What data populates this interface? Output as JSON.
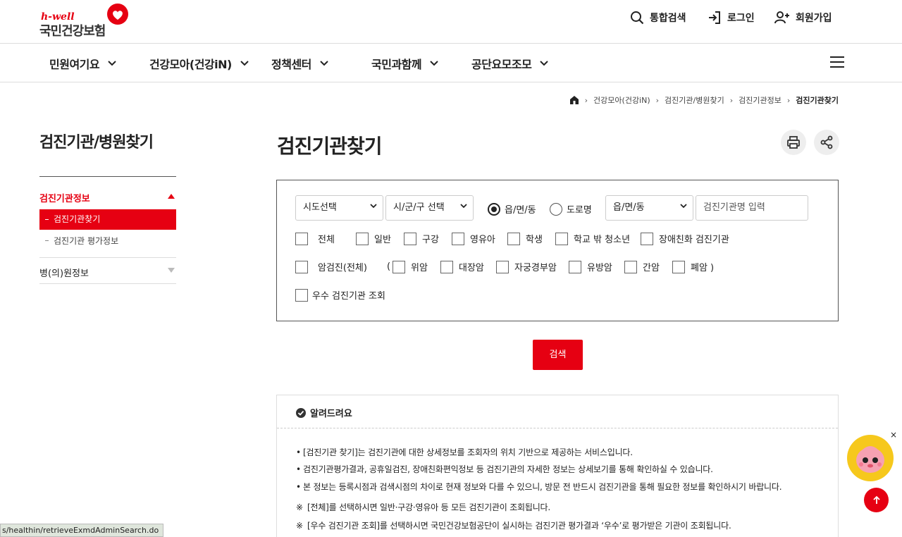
{
  "header": {
    "logo_brand": "h-well",
    "logo_name": "국민건강보험",
    "search_label": "통합검색",
    "login_label": "로그인",
    "join_label": "회원가입"
  },
  "gnb": {
    "items": [
      {
        "label": "민원여기요"
      },
      {
        "label": "건강모아(건강iN)"
      },
      {
        "label": "정책센터"
      },
      {
        "label": "국민과함께"
      },
      {
        "label": "공단요모조모"
      }
    ]
  },
  "breadcrumb": {
    "items": [
      "건강모아(건강iN)",
      "검진기관/병원찾기",
      "검진기관정보"
    ],
    "current": "검진기관찾기"
  },
  "sidebar": {
    "title": "검진기관/병원찾기",
    "group1": "검진기관정보",
    "active_item": "검진기관찾기",
    "sub_item": "검진기관 평가정보",
    "group2": "병(의)원정보"
  },
  "page": {
    "title": "검진기관찾기"
  },
  "search": {
    "sido_select": "시도선택",
    "sigungu_select": "시/군/구 선택",
    "radio_emd": "읍/면/동",
    "radio_road": "도로명",
    "emd_select": "읍/면/동",
    "name_placeholder": "검진기관명 입력",
    "row1": [
      "전체",
      "일반",
      "구강",
      "영유아",
      "학생",
      "학교 밖 청소년",
      "장애친화 검진기관"
    ],
    "cancer_all": "암검진(전체)",
    "paren_open": "(",
    "row2": [
      "위암",
      "대장암",
      "자궁경부암",
      "유방암",
      "간암",
      "폐암 )"
    ],
    "excellent": "우수 검진기관 조회",
    "button": "검색"
  },
  "notice": {
    "title": "알려드려요",
    "bullets": [
      "[검진기관 찾기]는 검진기관에 대한 상세정보를 조회자의 위치 기반으로 제공하는 서비스입니다.",
      "검진기관평가결과, 공휴일검진, 장애친화편익정보 등 검진기관의 자세한 정보는 상세보기를 통해 확인하실 수 있습니다.",
      "본 정보는 등록시점과 검색시점의 차이로 현재 정보와 다를 수 있으니, 방문 전 반드시 검진기관을 통해 필요한 정보를 확인하시기 바랍니다."
    ],
    "bullet_mark": "•",
    "note_mark": "※",
    "notes": [
      "[전체]를 선택하시면 일반·구강·영유아 등 모든 검진기관이 조회됩니다.",
      "[우수 검진기관 조회]를 선택하시면 국민건강보험공단이 실시하는 검진기관 평가결과 ‘우수’로 평가받은 기관이 조회됩니다."
    ]
  },
  "floating": {
    "close": "×"
  },
  "status_url": "s/healthin/retrieveExmdAdminSearch.do",
  "colors": {
    "brand_red": "#e60012"
  }
}
